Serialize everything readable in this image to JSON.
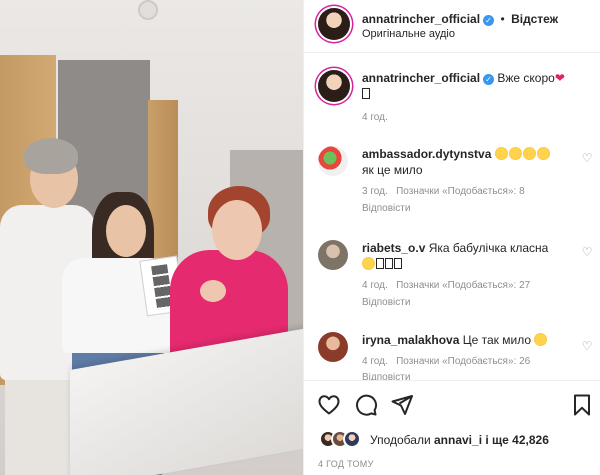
{
  "post": {
    "author": "annatrincher_official",
    "follow_label": "Відстеж",
    "audio": "Оригінальне аудіо"
  },
  "caption": {
    "username": "annatrincher_official",
    "text": "Вже скоро",
    "time": "4 год."
  },
  "comments": [
    {
      "username": "ambassador.dytynstva",
      "text": "як це мило",
      "time": "3 год.",
      "likes": "Позначки «Подобається»: 8",
      "reply": "Відповісти"
    },
    {
      "username": "riabets_o.v",
      "text": "Яка бабулічка класна",
      "time": "4 год.",
      "likes": "Позначки «Подобається»: 27",
      "reply": "Відповісти"
    },
    {
      "username": "iryna_malakhova",
      "text": "Це так мило",
      "time": "4 год.",
      "likes": "Позначки «Подобається»: 26",
      "reply": "Відповісти"
    }
  ],
  "footer": {
    "liked_by_prefix": "Уподобали",
    "liked_by_user": "annavi_i",
    "liked_by_suffix": "і ще 42,826",
    "timestamp": "4 ГОД ТОМУ"
  },
  "icons": {
    "like": "heart-icon",
    "comment": "comment-icon",
    "share": "share-icon",
    "save": "bookmark-icon"
  },
  "colors": {
    "verified": "#3897f0",
    "text": "#262626",
    "muted": "#8e8e8e",
    "heart": "#e0245e"
  }
}
